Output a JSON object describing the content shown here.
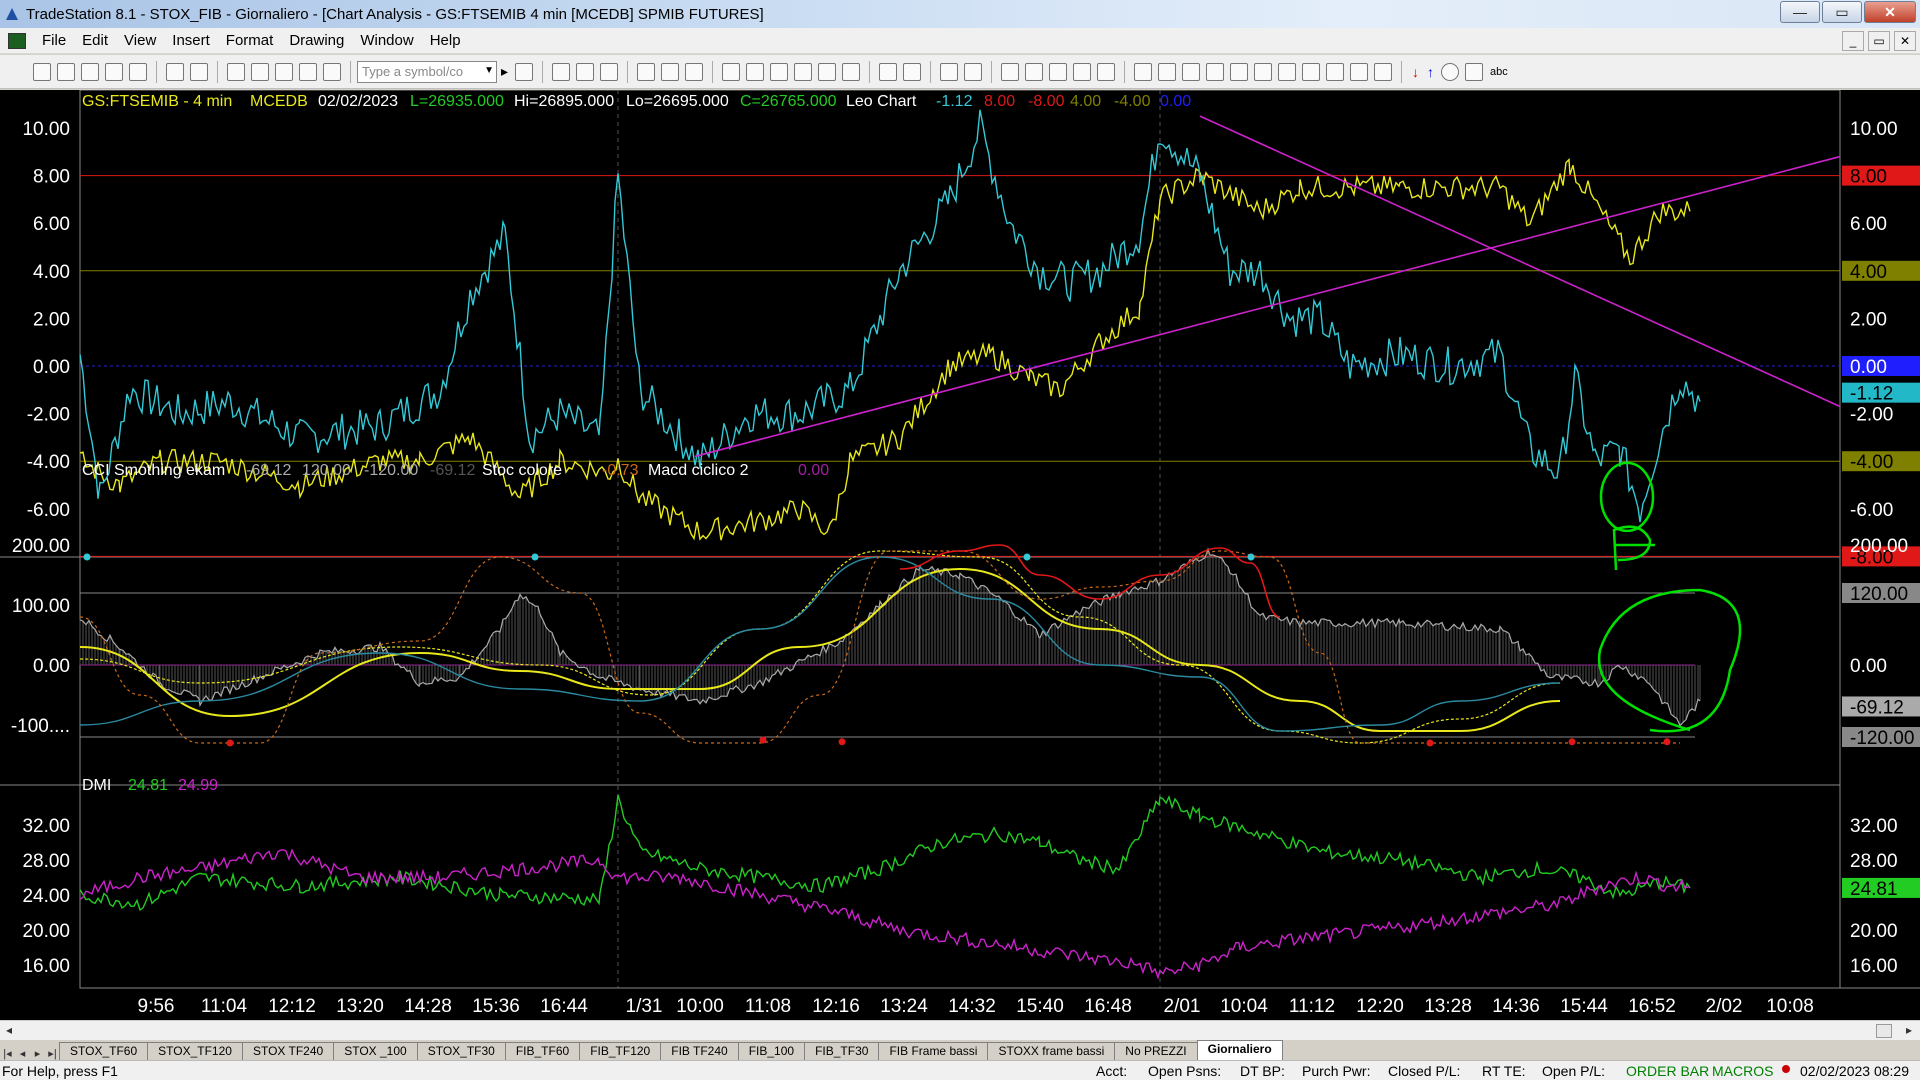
{
  "window": {
    "title": "TradeStation 8.1 - STOX_FIB - Giornaliero - [Chart Analysis - GS:FTSEMIB  4 min  [MCEDB] SPMIB FUTURES]",
    "buttons": [
      "—",
      "▭",
      "✕"
    ]
  },
  "menu": [
    "File",
    "Edit",
    "View",
    "Insert",
    "Format",
    "Drawing",
    "Window",
    "Help"
  ],
  "toolbar": {
    "symbol_placeholder": "Type a symbol/co",
    "label_abc": "abc"
  },
  "chart": {
    "header": {
      "symbol": "GS:FTSEMIB - 4 min",
      "source": "MCEDB",
      "date": "02/02/2023",
      "low_close_open": "L=26935.000",
      "high": "Hi=26895.000",
      "low": "Lo=26695.000",
      "close": "C=26765.000",
      "study": "Leo Chart",
      "v1": "-1.12",
      "v2": "8.00",
      "v3": "-8.00",
      "v4": "4.00",
      "v5": "-4.00",
      "v6": "0.00"
    },
    "pane1": {
      "axis_ticks": [
        "10.00",
        "8.00",
        "6.00",
        "4.00",
        "2.00",
        "0.00",
        "-2.00",
        "-4.00",
        "-6.00"
      ],
      "right_labels": [
        "10.00",
        "8.00",
        "6.00",
        "4.00",
        "2.00",
        "0.00",
        "-1.12",
        "-2.00",
        "-4.00",
        "-6.00",
        "-8.00"
      ]
    },
    "pane2": {
      "title": "CCI Smothing ekam",
      "vals": [
        "-69.12",
        "120.00",
        "-120.00",
        "-69.12"
      ],
      "stoc": "Stoc colore",
      "stoc_val": "-0.73",
      "macd": "Macd ciclico 2",
      "macd_val": "0.00",
      "axis_ticks": [
        "200.00",
        "100.00",
        "0.00",
        "-100...."
      ],
      "right_labels": [
        "200.00",
        "120.00",
        "0.00",
        "-69.12",
        "-120.00"
      ]
    },
    "pane3": {
      "title": "DMI",
      "v1": "24.81",
      "v2": "24.99",
      "axis_ticks": [
        "32.00",
        "28.00",
        "24.00",
        "20.00",
        "16.00"
      ],
      "right_labels": [
        "32.00",
        "28.00",
        "24.81",
        "20.00",
        "16.00"
      ]
    },
    "time_labels": [
      "9:56",
      "11:04",
      "12:12",
      "13:20",
      "14:28",
      "15:36",
      "16:44",
      "1/31",
      "10:00",
      "11:08",
      "12:16",
      "13:24",
      "14:32",
      "15:40",
      "16:48",
      "2/01",
      "10:04",
      "11:12",
      "12:20",
      "13:28",
      "14:36",
      "15:44",
      "16:52",
      "2/02",
      "10:08"
    ],
    "colors": {
      "cyan": "#33c9d6",
      "yellow": "#e8e81a",
      "magenta": "#cc22cc",
      "green": "#22cc22",
      "red": "#e01818",
      "olive": "#808000"
    }
  },
  "tabs": [
    "STOX_TF60",
    "STOX_TF120",
    "STOX TF240",
    "STOX _100",
    "STOX_TF30",
    "FIB_TF60",
    "FIB_TF120",
    "FIB TF240",
    "FIB_100",
    "FIB_TF30",
    "FIB Frame bassi",
    "STOXX frame bassi",
    "No PREZZI",
    "Giornaliero"
  ],
  "status": {
    "help": "For Help, press F1",
    "acct": "Acct:",
    "open_psns": "Open Psns:",
    "dt_bp": "DT BP:",
    "purch_pwr": "Purch Pwr:",
    "closed_pl": "Closed P/L:",
    "rt_te": "RT TE:",
    "open_pl": "Open P/L:",
    "order_bar": "ORDER BAR",
    "macros": "MACROS",
    "datetime": "02/02/2023 08:29"
  }
}
